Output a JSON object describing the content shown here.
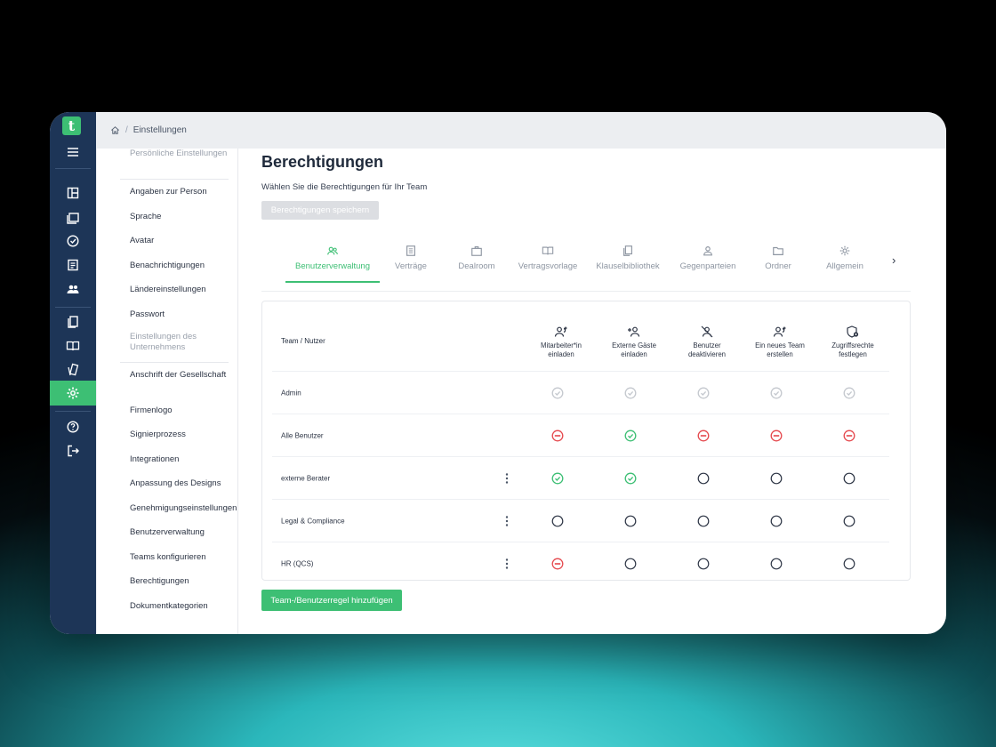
{
  "breadcrumb": {
    "current": "Einstellungen"
  },
  "rail": {
    "logo": "t"
  },
  "settings_nav": {
    "group_personal": "Persönliche Einstellungen",
    "personal_items": [
      "Angaben zur Person",
      "Sprache",
      "Avatar",
      "Benachrichtigungen",
      "Ländereinstellungen",
      "Passwort"
    ],
    "group_company": "Einstellungen des Unternehmens",
    "company_items": [
      "Anschrift der Gesellschaft",
      "Firmenlogo",
      "Signierprozess",
      "Integrationen",
      "Anpassung des Designs",
      "Genehmigungseinstellungen",
      "Benutzerverwaltung",
      "Teams konfigurieren",
      "Berechtigungen",
      "Dokumentkategorien"
    ]
  },
  "page": {
    "title": "Berechtigungen",
    "subtitle": "Wählen Sie die Berechtigungen für Ihr Team",
    "save_label": "Berechtigungen speichern",
    "add_label": "Team-/Benutzerregel hinzufügen"
  },
  "tabs": [
    {
      "label": "Benutzerverwaltung",
      "icon": "users-icon",
      "active": true
    },
    {
      "label": "Verträge",
      "icon": "document-icon"
    },
    {
      "label": "Dealroom",
      "icon": "briefcase-icon"
    },
    {
      "label": "Vertragsvorlage",
      "icon": "book-icon"
    },
    {
      "label": "Klauselbibliothek",
      "icon": "copy-icon"
    },
    {
      "label": "Gegenparteien",
      "icon": "person-icon"
    },
    {
      "label": "Ordner",
      "icon": "folder-icon"
    },
    {
      "label": "Allgemein",
      "icon": "gear-icon"
    }
  ],
  "table": {
    "header_team": "Team / Nutzer",
    "columns": [
      {
        "label": "Mitarbeiter*in einladen",
        "icon": "invite-member-icon"
      },
      {
        "label": "Externe Gäste einladen",
        "icon": "invite-guest-icon"
      },
      {
        "label": "Benutzer deaktivieren",
        "icon": "deactivate-user-icon"
      },
      {
        "label": "Ein neues Team erstellen",
        "icon": "create-team-icon"
      },
      {
        "label": "Zugriffsrechte festlegen",
        "icon": "access-rights-icon"
      }
    ],
    "rows": [
      {
        "name": "Admin",
        "menu": false,
        "perms": [
          "locked",
          "locked",
          "locked",
          "locked",
          "locked"
        ]
      },
      {
        "name": "Alle Benutzer",
        "menu": false,
        "perms": [
          "denied",
          "allowed",
          "denied",
          "denied",
          "denied"
        ]
      },
      {
        "name": "externe Berater",
        "menu": true,
        "perms": [
          "allowed",
          "allowed",
          "none",
          "none",
          "none"
        ]
      },
      {
        "name": "Legal & Compliance",
        "menu": true,
        "perms": [
          "none",
          "none",
          "none",
          "none",
          "none"
        ]
      },
      {
        "name": "HR (QCS)",
        "menu": true,
        "perms": [
          "denied",
          "none",
          "none",
          "none",
          "none"
        ]
      }
    ]
  },
  "colors": {
    "accent": "#3dbf74",
    "denied": "#e5484d",
    "rail": "#1d3557",
    "locked": "#c4c8ce"
  }
}
